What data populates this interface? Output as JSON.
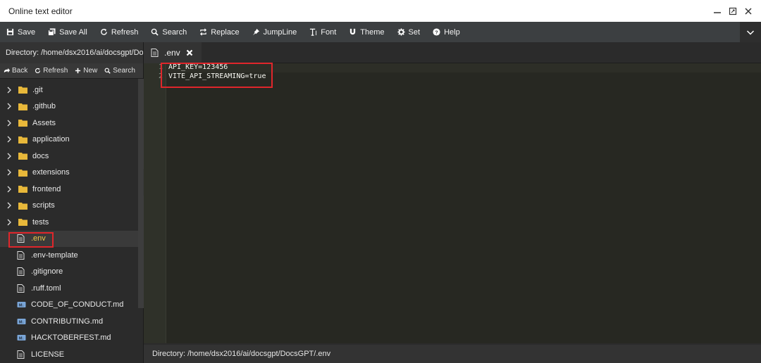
{
  "window": {
    "title": "Online text editor"
  },
  "toolbar": {
    "save": "Save",
    "save_all": "Save All",
    "refresh": "Refresh",
    "search": "Search",
    "replace": "Replace",
    "jumpline": "JumpLine",
    "font": "Font",
    "theme": "Theme",
    "set": "Set",
    "help": "Help"
  },
  "sidebar": {
    "directory": "Directory: /home/dsx2016/ai/docsgpt/Doc...",
    "actions": {
      "back": "Back",
      "refresh": "Refresh",
      "new": "New",
      "search": "Search"
    },
    "folders": [
      {
        "name": ".git"
      },
      {
        "name": ".github"
      },
      {
        "name": "Assets"
      },
      {
        "name": "application"
      },
      {
        "name": "docs"
      },
      {
        "name": "extensions"
      },
      {
        "name": "frontend"
      },
      {
        "name": "scripts"
      },
      {
        "name": "tests"
      }
    ],
    "files": [
      {
        "name": ".env",
        "icon": "document-icon",
        "selected": true
      },
      {
        "name": ".env-template",
        "icon": "document-icon"
      },
      {
        "name": ".gitignore",
        "icon": "document-icon"
      },
      {
        "name": ".ruff.toml",
        "icon": "document-icon"
      },
      {
        "name": "CODE_OF_CONDUCT.md",
        "icon": "markdown-icon"
      },
      {
        "name": "CONTRIBUTING.md",
        "icon": "markdown-icon"
      },
      {
        "name": "HACKTOBERFEST.md",
        "icon": "markdown-icon"
      },
      {
        "name": "LICENSE",
        "icon": "document-icon"
      }
    ]
  },
  "tab": {
    "label": ".env"
  },
  "editor": {
    "line_numbers": [
      "1",
      "2"
    ],
    "lines": [
      "API_KEY=123456",
      "VITE_API_STREAMING=true"
    ]
  },
  "status": {
    "path": "Directory: /home/dsx2016/ai/docsgpt/DocsGPT/.env"
  },
  "colors": {
    "accent_highlight": "#e0262b",
    "folder": "#e8b83a",
    "selected_text": "#f0c94a"
  }
}
